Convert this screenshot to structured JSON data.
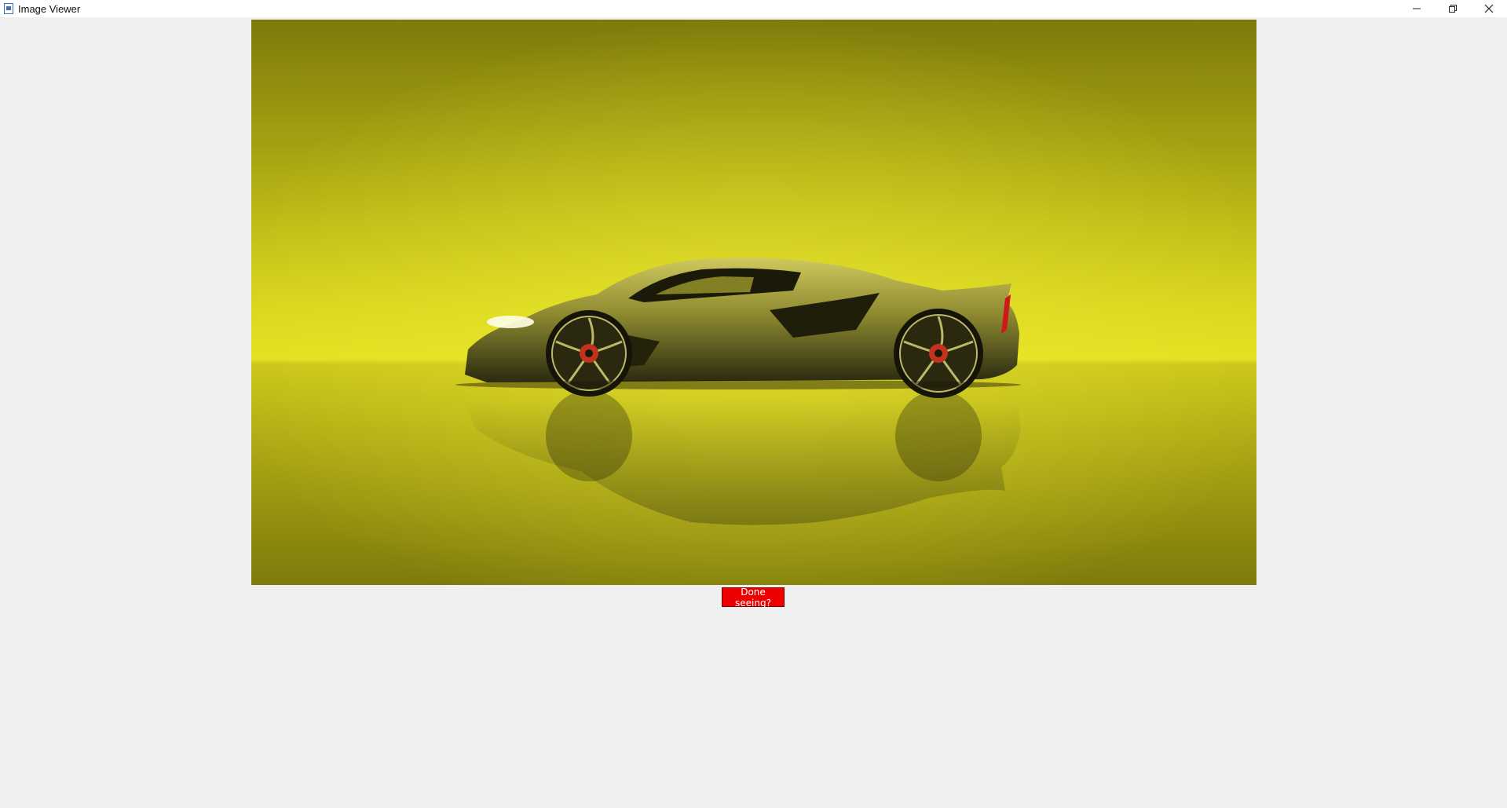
{
  "window": {
    "title": "Image Viewer",
    "controls": [
      "minimize-icon",
      "restore-icon",
      "close-icon"
    ]
  },
  "viewer": {
    "image_icon": "photo-of-yellow-sports-car",
    "background_color": "#e3e020"
  },
  "actions": {
    "done_label": "Done seeing?",
    "done_color": "#ee0000"
  }
}
